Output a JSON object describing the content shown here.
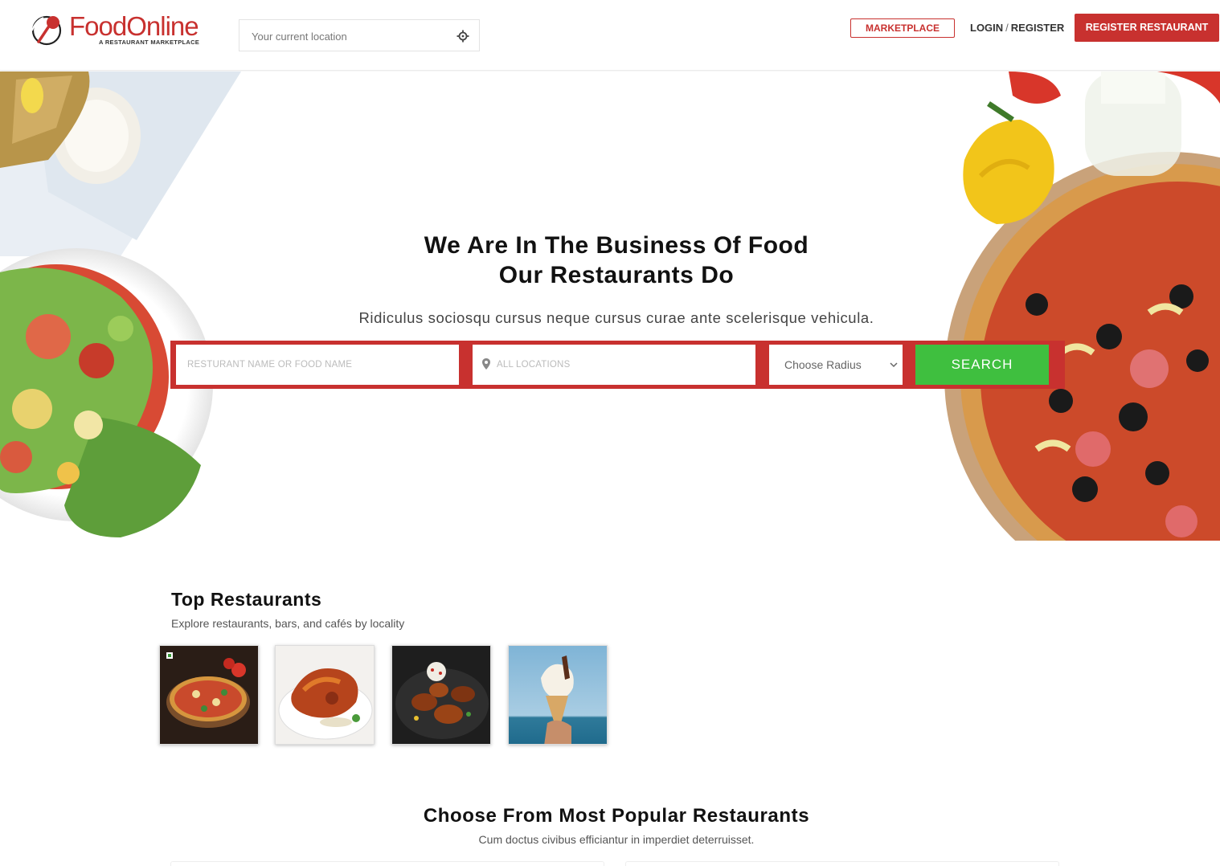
{
  "brand": {
    "name": "FoodOnline",
    "tagline": "A RESTAURANT MARKETPLACE",
    "color": "#c8312f"
  },
  "header": {
    "location_placeholder": "Your current location",
    "marketplace_label": "MARKETPLACE",
    "login_label": "LOGIN",
    "login_separator": "/",
    "register_label": "REGISTER",
    "register_restaurant_label": "REGISTER RESTAURANT",
    "icons": [
      "logo-icon",
      "crosshair-icon"
    ]
  },
  "hero": {
    "title_line1": "We Are In The Business Of Food",
    "title_line2": "Our Restaurants Do",
    "subtitle": "Ridiculus sociosqu cursus neque cursus curae ante scelerisque vehicula.",
    "search": {
      "name_placeholder": "RESTURANT NAME OR FOOD NAME",
      "location_placeholder": "ALL LOCATIONS",
      "radius_selected": "Choose Radius",
      "search_label": "SEARCH",
      "button_color": "#3fbf3f"
    }
  },
  "top_restaurants": {
    "title": "Top Restaurants",
    "subtitle": "Explore restaurants, bars, and cafés by locality",
    "items": [
      {
        "image": "pizza-image"
      },
      {
        "image": "roast-chicken-image"
      },
      {
        "image": "chicken-wings-image"
      },
      {
        "image": "ice-cream-image"
      }
    ]
  },
  "popular": {
    "title": "Choose From Most Popular Restaurants",
    "subtitle": "Cum doctus civibus efficiantur in imperdiet deterruisset."
  }
}
